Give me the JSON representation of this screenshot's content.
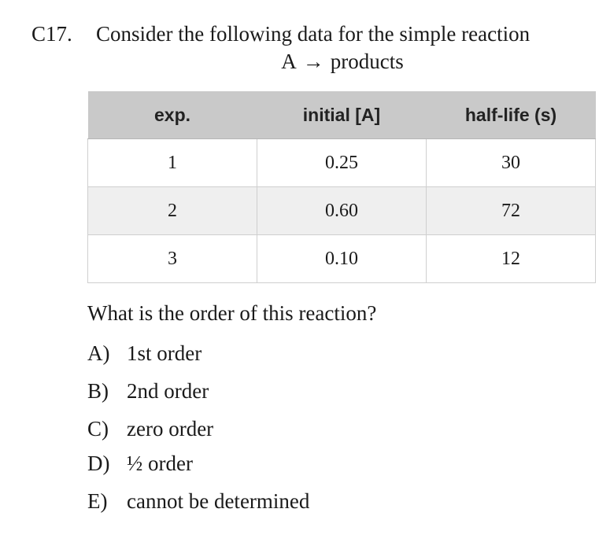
{
  "question": {
    "number": "C17.",
    "text": "Consider the following data for the simple reaction",
    "reaction": {
      "reactant": "A",
      "arrow": "→",
      "product": "products"
    }
  },
  "table": {
    "headers": [
      "exp.",
      "initial [A]",
      "half-life (s)"
    ],
    "rows": [
      [
        "1",
        "0.25",
        "30"
      ],
      [
        "2",
        "0.60",
        "72"
      ],
      [
        "3",
        "0.10",
        "12"
      ]
    ]
  },
  "prompt": "What is the order of this reaction?",
  "choices": [
    {
      "letter": "A)",
      "text": "1st order"
    },
    {
      "letter": "B)",
      "text": "2nd order"
    },
    {
      "letter": "C)",
      "text": "zero order"
    },
    {
      "letter": "D)",
      "text": "½ order"
    },
    {
      "letter": "E)",
      "text": "cannot be determined"
    }
  ]
}
